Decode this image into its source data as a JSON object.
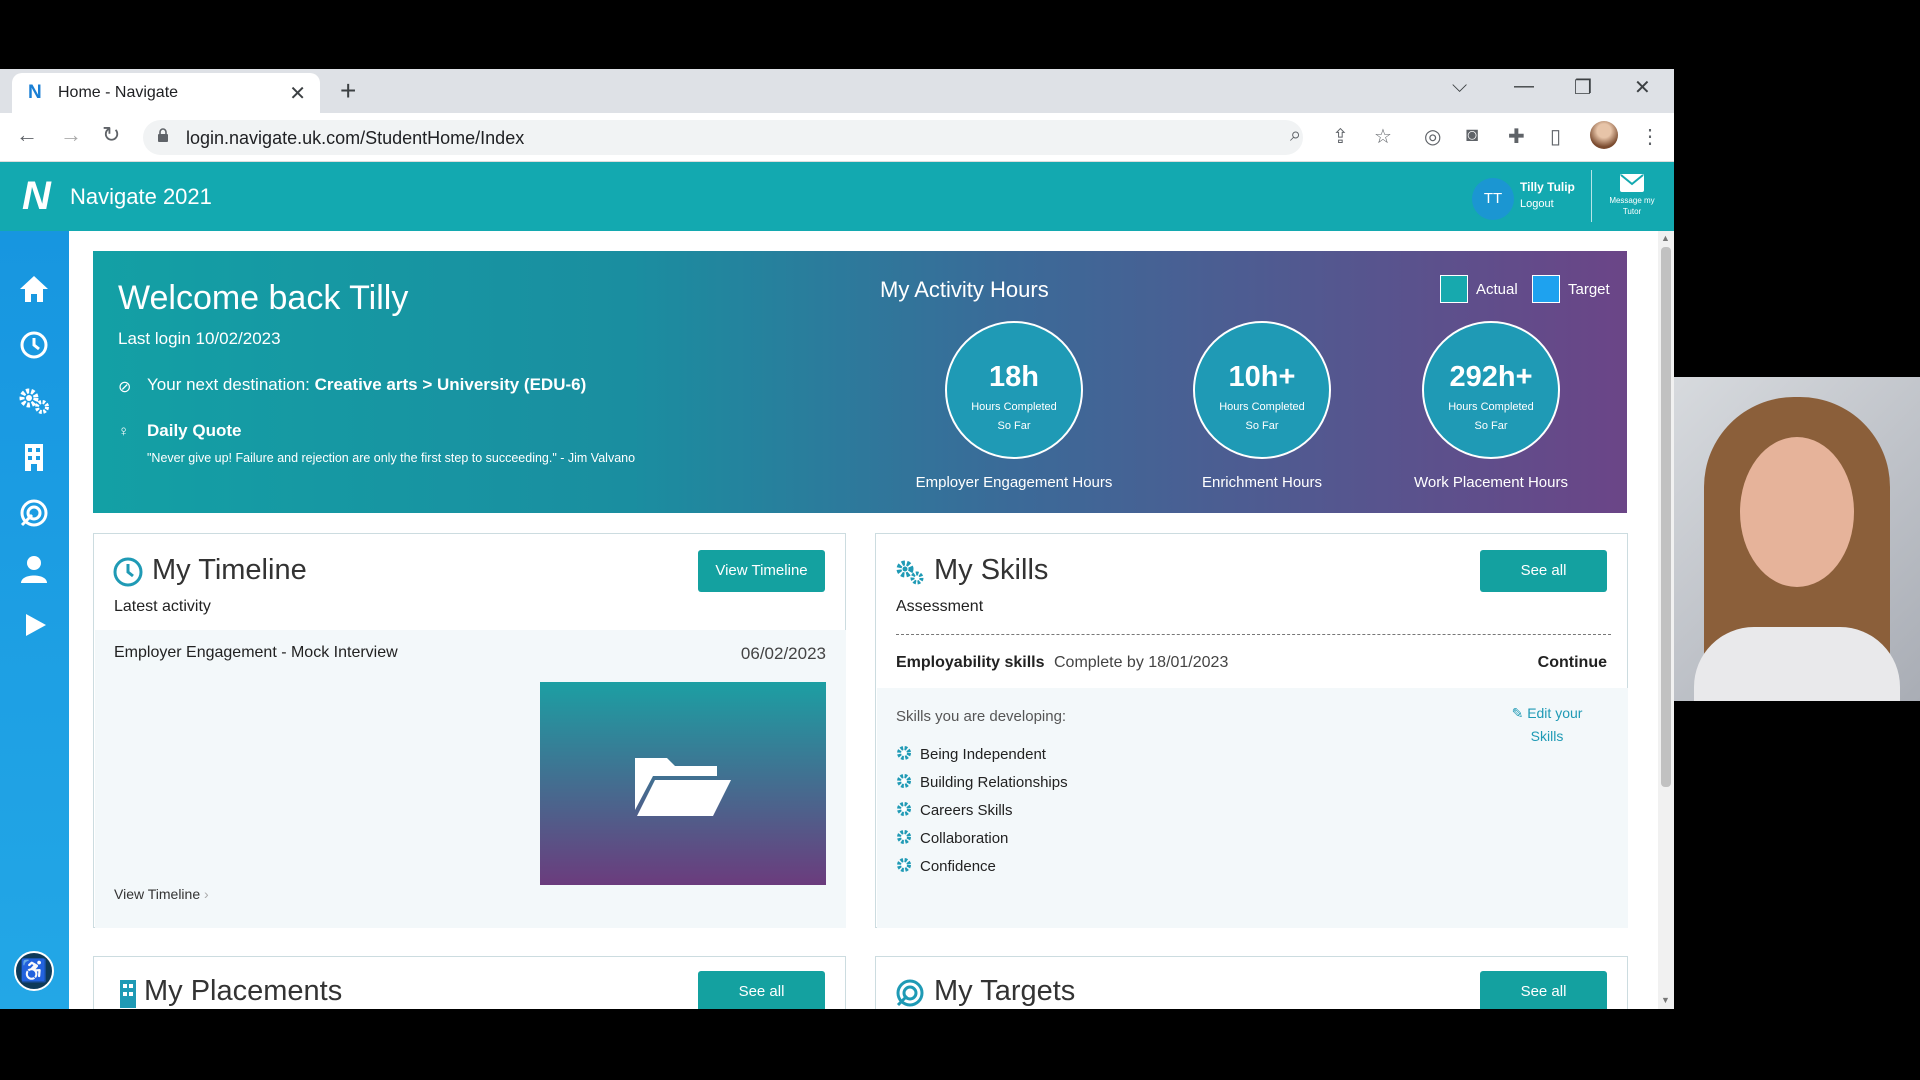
{
  "browser": {
    "tab_title": "Home - Navigate",
    "tab_favicon": "N",
    "url": "login.navigate.uk.com/StudentHome/Index"
  },
  "app": {
    "title": "Navigate 2021",
    "user_initials": "TT",
    "user_name": "Tilly Tulip",
    "logout": "Logout",
    "message_label": "Message my Tutor",
    "brand_color": "#13a9b0",
    "sidebar_icons": [
      "home-icon",
      "clock-icon",
      "gears-icon",
      "building-icon",
      "target-icon",
      "person-icon",
      "play-icon"
    ]
  },
  "banner": {
    "welcome": "Welcome back Tilly",
    "last_login": "Last login 10/02/2023",
    "destination_label": "Your next destination: ",
    "destination_value": "Creative arts > University (EDU-6)",
    "quote_title": "Daily Quote",
    "quote": "\"Never give up! Failure and rejection are only the first step to succeeding.\" - Jim Valvano",
    "hours_title": "My Activity Hours",
    "legend": {
      "actual": "Actual",
      "target": "Target",
      "actual_color": "#17a9ae",
      "target_color": "#1ea2ef"
    },
    "circles": [
      {
        "value": "18h",
        "line1": "Hours Completed",
        "line2": "So Far",
        "label": "Employer Engagement Hours"
      },
      {
        "value": "10h+",
        "line1": "Hours Completed",
        "line2": "So Far",
        "label": "Enrichment Hours"
      },
      {
        "value": "292h+",
        "line1": "Hours Completed",
        "line2": "So Far",
        "label": "Work Placement Hours"
      }
    ]
  },
  "timeline": {
    "title": "My Timeline",
    "button": "View Timeline",
    "subtitle": "Latest activity",
    "activity_name": "Employer Engagement - Mock Interview",
    "activity_date": "06/02/2023",
    "link": "View Timeline"
  },
  "skills": {
    "title": "My Skills",
    "button": "See all",
    "subtitle": "Assessment",
    "assessment_name": "Employability skills",
    "complete_by": "Complete by 18/01/2023",
    "continue": "Continue",
    "developing_title": "Skills you are developing:",
    "edit_line1": "Edit your",
    "edit_line2": "Skills",
    "items": [
      "Being Independent",
      "Building Relationships",
      "Careers Skills",
      "Collaboration",
      "Confidence"
    ]
  },
  "placements": {
    "title": "My Placements",
    "button": "See all"
  },
  "targets": {
    "title": "My Targets",
    "button": "See all"
  }
}
